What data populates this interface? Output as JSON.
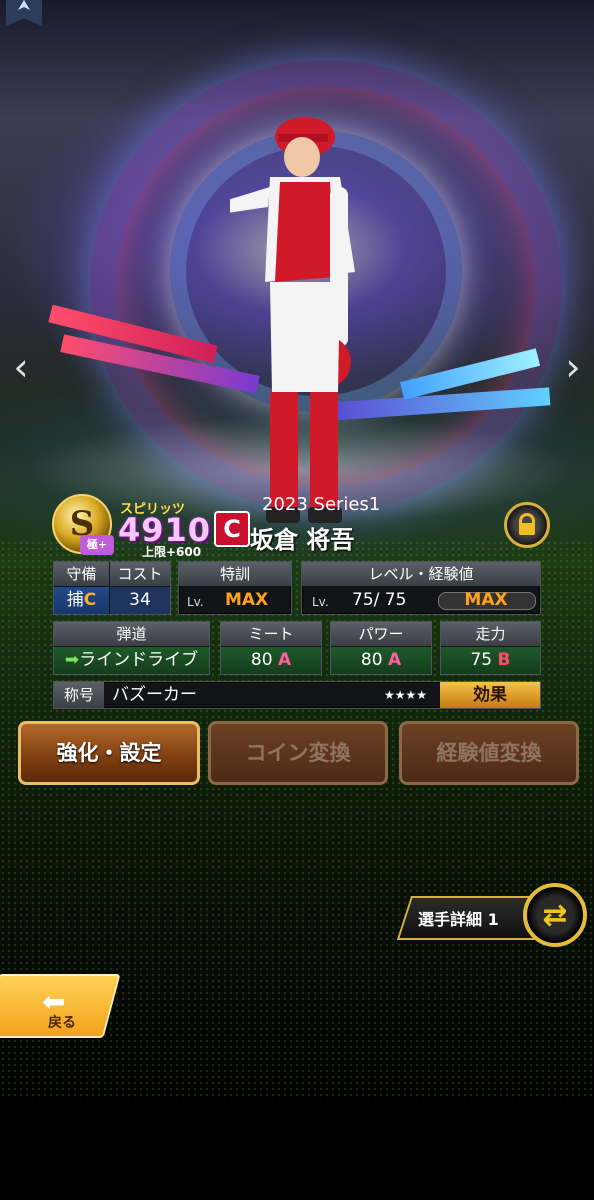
{
  "player": {
    "spirits_label": "スピリッツ",
    "spirits_value": "4910",
    "cap_label": "上限+600",
    "rank": "S",
    "rank_sub": "極+",
    "team_logo": "C",
    "series": "2023 Series1",
    "name": "坂倉 将吾"
  },
  "stats": {
    "position_header": "守備",
    "position_value": "捕",
    "position_grade": "C",
    "cost_header": "コスト",
    "cost_value": "34",
    "training_header": "特訓",
    "training_lv": "Lv.",
    "training_value": "MAX",
    "level_header": "レベル・経験値",
    "level_lv": "Lv.",
    "level_value": "75/ 75",
    "exp_value": "MAX",
    "trajectory_header": "弾道",
    "trajectory_value": "ラインドライブ",
    "meet_header": "ミート",
    "meet_value": "80",
    "meet_grade": "A",
    "power_header": "パワー",
    "power_value": "80",
    "power_grade": "A",
    "speed_header": "走力",
    "speed_value": "75",
    "speed_grade": "B",
    "title_label": "称号",
    "title_value": "バズーカー",
    "title_stars": "★★★★",
    "effect_button": "効果"
  },
  "actions": {
    "enhance": "強化・設定",
    "coin_exchange": "コイン変換",
    "exp_exchange": "経験値変換"
  },
  "footer": {
    "detail_label": "選手詳細 1",
    "back_label": "戻る"
  },
  "colors": {
    "gold": "#e2bd3b",
    "max_orange": "#ffa21a",
    "team_red": "#c8102e"
  }
}
